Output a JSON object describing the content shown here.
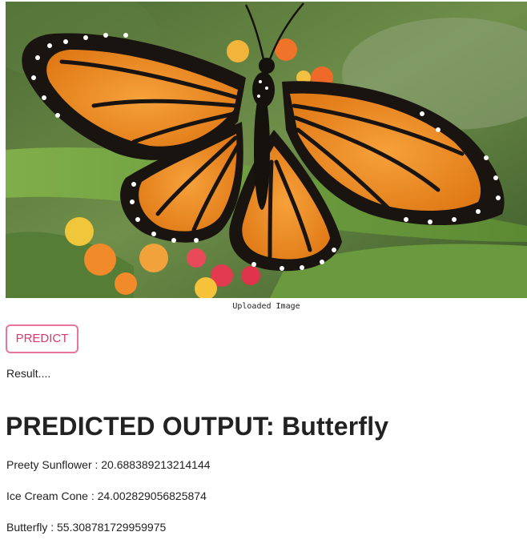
{
  "image": {
    "alt": "Monarch butterfly on orange flowers",
    "caption": "Uploaded Image"
  },
  "predict_button": {
    "label": "PREDICT"
  },
  "result_label": "Result....",
  "predicted_output": "PREDICTED OUTPUT: Butterfly",
  "scores": [
    "Preety Sunflower : 20.688389213214144",
    "Ice Cream Cone : 24.002829056825874",
    "Butterfly : 55.308781729959975"
  ],
  "colors": {
    "button_border": "#e8769a",
    "button_text": "#d63b6e"
  }
}
